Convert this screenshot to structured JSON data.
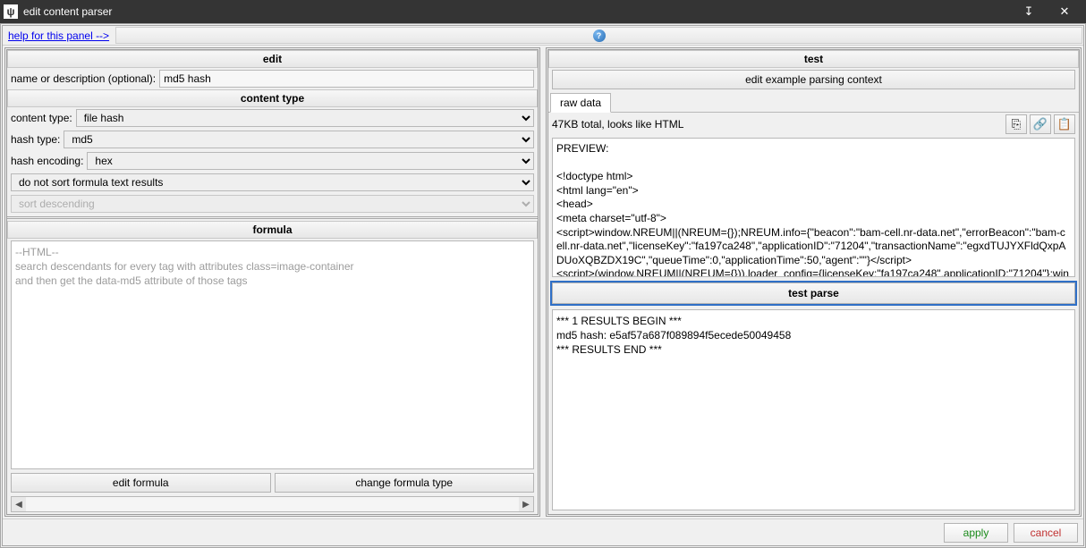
{
  "window": {
    "title": "edit content parser"
  },
  "help": {
    "link": "help for this panel -->"
  },
  "left": {
    "edit_header": "edit",
    "name_label": "name or description (optional):",
    "name_value": "md5 hash",
    "content_type_header": "content type",
    "content_type_label": "content type:",
    "content_type_value": "file hash",
    "hash_type_label": "hash type:",
    "hash_type_value": "md5",
    "hash_encoding_label": "hash encoding:",
    "hash_encoding_value": "hex",
    "sort_option": "do not sort formula text results",
    "sort_disabled": "sort descending",
    "formula_header": "formula",
    "formula_text": "--HTML--\nsearch descendants for every tag with attributes class=image-container\nand then get the data-md5 attribute of those tags",
    "edit_formula_btn": "edit formula",
    "change_formula_btn": "change formula type"
  },
  "right": {
    "test_header": "test",
    "edit_example_btn": "edit example parsing context",
    "tab_raw": "raw data",
    "status": "47KB total, looks like HTML",
    "preview": "PREVIEW:\n\n<!doctype html>\n<html lang=\"en\">\n<head>\n  <meta charset=\"utf-8\">\n<script>window.NREUM||(NREUM={});NREUM.info={\"beacon\":\"bam-cell.nr-data.net\",\"errorBeacon\":\"bam-cell.nr-data.net\",\"licenseKey\":\"fa197ca248\",\"applicationID\":\"71204\",\"transactionName\":\"egxdTUJYXFldQxpADUoXQBZDX19C\",\"queueTime\":0,\"applicationTime\":50,\"agent\":\"\"}</script>\n<script>(window.NREUM||(NREUM={})).loader_config={licenseKey:\"fa197ca248\",applicationID:\"71204\"};window.NREUM||(NREUM={}),__nr_require=function(e,t,n){function r(n){if(!t[n]){var i=t[n]={exports:{}};e[n]",
    "test_parse_btn": "test parse",
    "results": "*** 1 RESULTS BEGIN ***\nmd5 hash: e5af57a687f089894f5ecede50049458\n*** RESULTS END ***"
  },
  "footer": {
    "apply": "apply",
    "cancel": "cancel"
  }
}
